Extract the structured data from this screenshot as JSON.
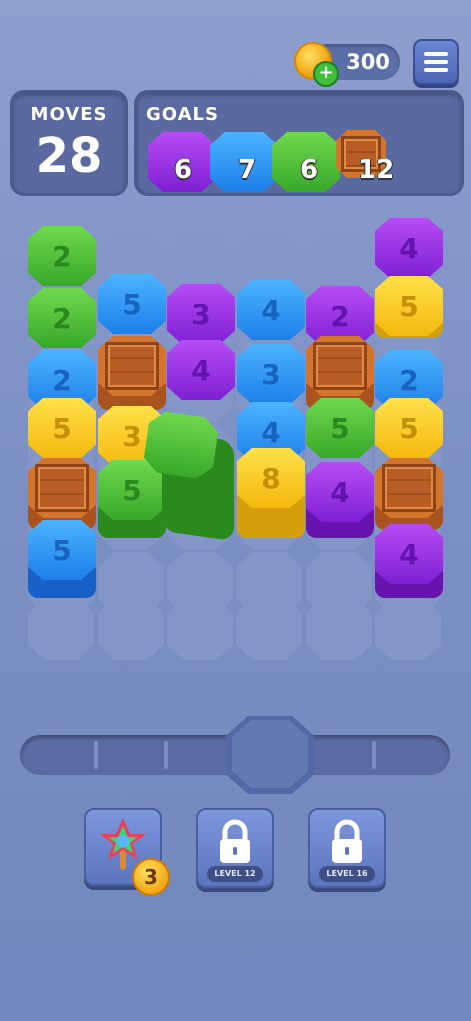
{
  "header": {
    "coins": "300",
    "coin_add_label": "+"
  },
  "moves": {
    "label": "MOVES",
    "value": "28"
  },
  "goals": {
    "label": "GOALS",
    "items": [
      {
        "color": "purple",
        "count": "6"
      },
      {
        "color": "blue",
        "count": "7"
      },
      {
        "color": "green",
        "count": "6"
      },
      {
        "color": "crate",
        "count": "12"
      }
    ]
  },
  "board": {
    "tiles": [
      {
        "color": "green",
        "value": "2"
      },
      {
        "color": "green",
        "value": "2"
      },
      {
        "color": "blue",
        "value": "2"
      },
      {
        "color": "yellow",
        "value": "5"
      },
      {
        "color": "crate",
        "value": ""
      },
      {
        "color": "blue",
        "value": "5"
      },
      {
        "color": "blue",
        "value": "5"
      },
      {
        "color": "crate",
        "value": ""
      },
      {
        "color": "yellow",
        "value": "3"
      },
      {
        "color": "green",
        "value": "5"
      },
      {
        "color": "purple",
        "value": "3"
      },
      {
        "color": "purple",
        "value": "4"
      },
      {
        "color": "blue",
        "value": "4"
      },
      {
        "color": "blue",
        "value": "3"
      },
      {
        "color": "blue",
        "value": "4"
      },
      {
        "color": "yellow",
        "value": "8"
      },
      {
        "color": "purple",
        "value": "2"
      },
      {
        "color": "crate",
        "value": ""
      },
      {
        "color": "green",
        "value": "5"
      },
      {
        "color": "purple",
        "value": "4"
      },
      {
        "color": "purple",
        "value": "4"
      },
      {
        "color": "yellow",
        "value": "5"
      },
      {
        "color": "blue",
        "value": "2"
      },
      {
        "color": "yellow",
        "value": "5"
      },
      {
        "color": "crate",
        "value": ""
      },
      {
        "color": "purple",
        "value": "4"
      }
    ]
  },
  "boosters": {
    "items": [
      {
        "type": "rainbow-flower",
        "count": "3"
      },
      {
        "type": "locked",
        "label": "LEVEL 12"
      },
      {
        "type": "locked",
        "label": "LEVEL 16"
      }
    ]
  }
}
